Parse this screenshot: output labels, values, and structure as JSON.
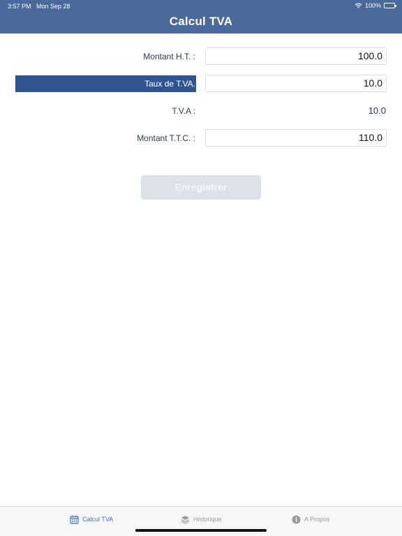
{
  "status_bar": {
    "time": "3:57 PM",
    "date": "Mon Sep 28",
    "battery": "100%"
  },
  "nav": {
    "title": "Calcul TVA"
  },
  "form": {
    "montant_ht": {
      "label": "Montant H.T. :",
      "value": "100.0"
    },
    "taux_tva": {
      "label": "Taux de T.VA.",
      "value": "10.0"
    },
    "tva": {
      "label": "T.V.A :",
      "value": "10.0"
    },
    "montant_ttc": {
      "label": "Montant T.T.C. :",
      "value": "110.0"
    }
  },
  "actions": {
    "save_label": "Enregistrer"
  },
  "tabbar": {
    "tabs": [
      {
        "label": "Calcul TVA",
        "icon": "calendar-icon",
        "active": true
      },
      {
        "label": "Historique",
        "icon": "layers-icon",
        "active": false
      },
      {
        "label": "A Propos",
        "icon": "info-icon",
        "active": false
      }
    ]
  },
  "colors": {
    "header": "#4a6a9c",
    "selected": "#2f5591",
    "tab_active": "#3b73c4",
    "tab_inactive": "#9a9a9a"
  }
}
